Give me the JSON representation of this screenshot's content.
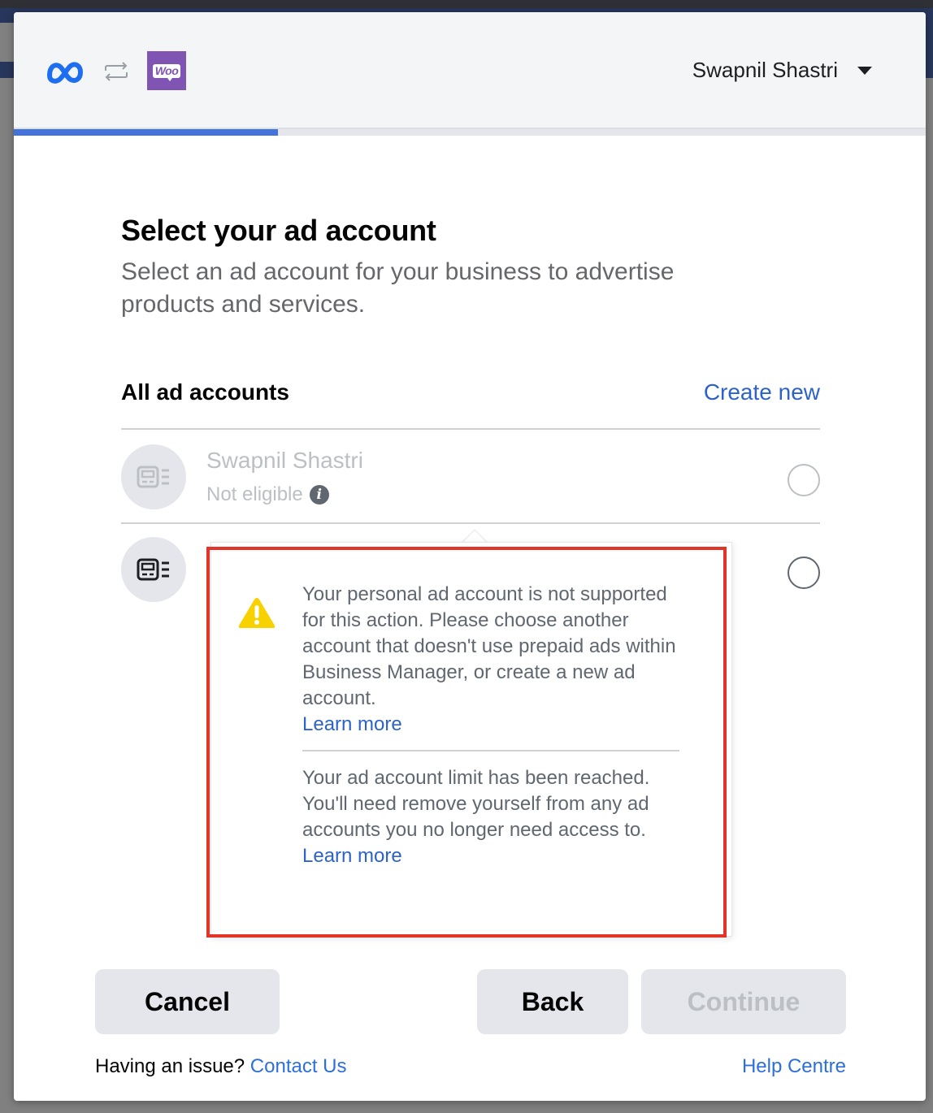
{
  "header": {
    "logos": [
      "meta-logo",
      "sync-icon",
      "woocommerce-logo"
    ],
    "woo_label": "Woo",
    "user_name": "Swapnil Shastri",
    "progress_fraction": 0.29
  },
  "main": {
    "title": "Select your ad account",
    "subtitle": "Select an ad account for your business to advertise products and services."
  },
  "accounts": {
    "heading": "All ad accounts",
    "create_new": "Create new",
    "items": [
      {
        "name": "Swapnil Shastri",
        "status": "Not eligible",
        "selected": false,
        "disabled": true
      },
      {
        "name": "",
        "status": "",
        "selected": false,
        "disabled": false
      }
    ]
  },
  "popover": {
    "message1": "Your personal ad account is not supported for this action. Please choose another account that doesn't use prepaid ads within Business Manager, or create a new ad account.",
    "learn_more_1": "Learn more",
    "message2": "Your ad account limit has been reached. You'll need remove yourself from any ad accounts you no longer need access to.",
    "learn_more_2": "Learn more"
  },
  "buttons": {
    "cancel": "Cancel",
    "back": "Back",
    "continue": "Continue"
  },
  "footer": {
    "issue_text": "Having an issue?",
    "contact": "Contact Us",
    "help": "Help Centre"
  },
  "colors": {
    "accent": "#2d63c8",
    "progress": "#4272db",
    "warning": "#f7d100",
    "highlight": "#e3342a",
    "woo_brand": "#7f54b3"
  }
}
